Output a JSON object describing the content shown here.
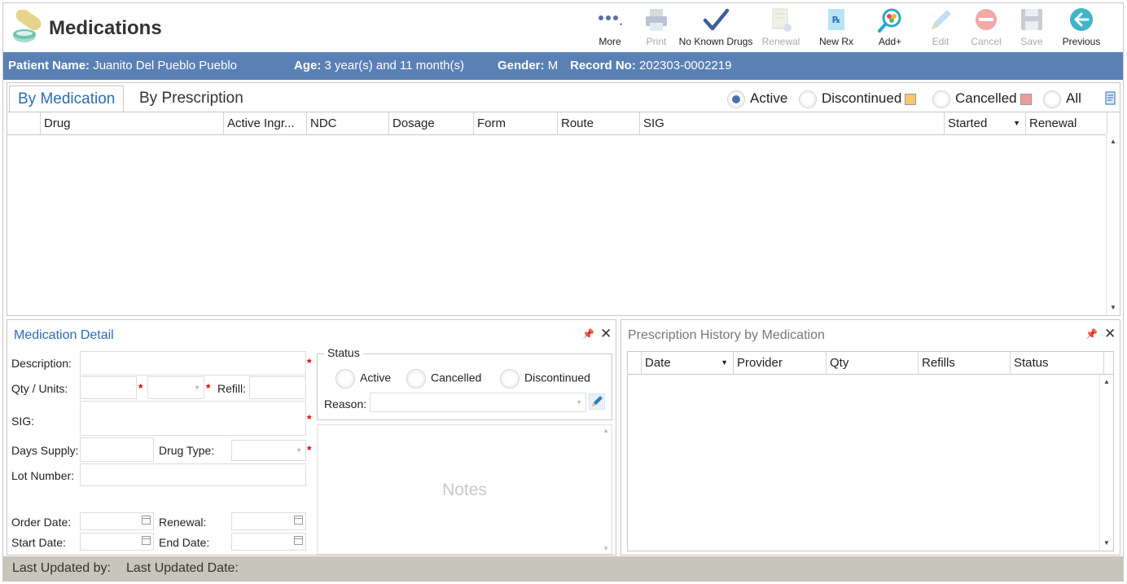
{
  "app": {
    "title": "Medications"
  },
  "toolbar": {
    "more": "More",
    "print": "Print",
    "no_known_drugs": "No Known Drugs",
    "renewal": "Renewal",
    "new_rx": "New Rx",
    "add": "Add+",
    "edit": "Edit",
    "cancel": "Cancel",
    "save": "Save",
    "previous": "Previous"
  },
  "patient": {
    "name_label": "Patient Name:",
    "name": "Juanito Del Pueblo Pueblo",
    "age_label": "Age:",
    "age": "3 year(s) and 11 month(s)",
    "gender_label": "Gender:",
    "gender": "M",
    "record_label": "Record No:",
    "record": "202303-0002219"
  },
  "tabs": [
    {
      "label": "By Medication",
      "active": true
    },
    {
      "label": "By Prescription",
      "active": false
    }
  ],
  "filter": {
    "active": "Active",
    "discontinued": "Discontinued",
    "cancelled": "Cancelled",
    "all": "All",
    "selected": "Active",
    "discontinued_color": "#f9c66b",
    "cancelled_color": "#ef9a9a"
  },
  "grid": {
    "columns": [
      "Drug",
      "Active Ingr...",
      "NDC",
      "Dosage",
      "Form",
      "Route",
      "SIG",
      "Started",
      "Renewal"
    ],
    "rows": []
  },
  "detail": {
    "title": "Medication Detail",
    "description": "Description:",
    "qty_units": "Qty / Units:",
    "refill": "Refill:",
    "sig": "SIG:",
    "days_supply": "Days Supply:",
    "drug_type": "Drug Type:",
    "lot_number": "Lot Number:",
    "order_date": "Order Date:",
    "renewal": "Renewal:",
    "start_date": "Start Date:",
    "end_date": "End Date:",
    "status_legend": "Status",
    "status_active": "Active",
    "status_cancelled": "Cancelled",
    "status_discontinued": "Discontinued",
    "reason": "Reason:",
    "notes_placeholder": "Notes"
  },
  "history": {
    "title": "Prescription History by Medication",
    "columns": [
      "Date",
      "Provider",
      "Qty",
      "Refills",
      "Status"
    ],
    "rows": []
  },
  "footer": {
    "last_updated_by": "Last Updated by:",
    "last_updated_date": "Last Updated Date:"
  }
}
